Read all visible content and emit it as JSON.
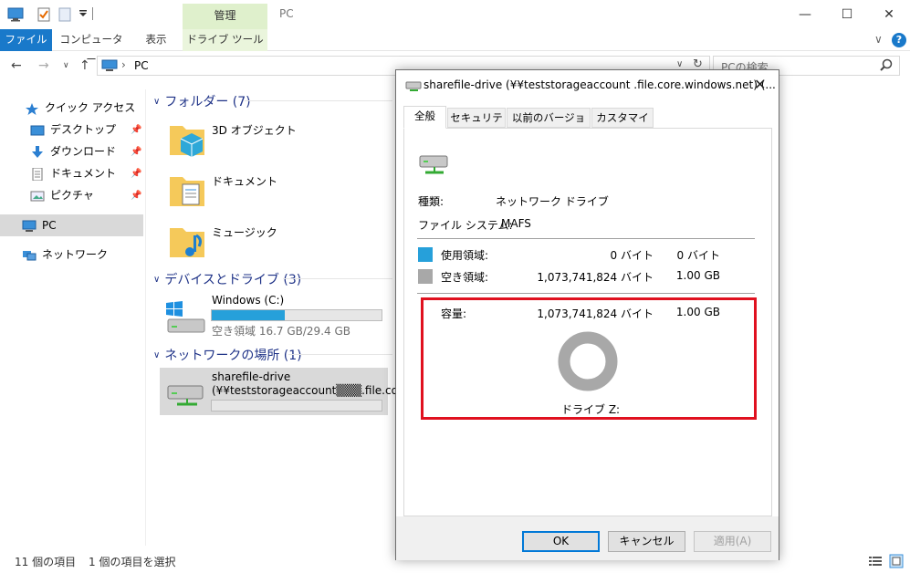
{
  "titlebar": {
    "manage_tab": "管理",
    "window_title": "PC",
    "minimize": "—",
    "maximize": "☐",
    "close": "✕"
  },
  "ribbon": {
    "tabs": [
      "ファイル",
      "コンピューター",
      "表示",
      "ドライブ ツール"
    ],
    "expand": "∨",
    "help": "?"
  },
  "address": {
    "path_sep": "›",
    "path": "PC",
    "search_placeholder": "PCの検索"
  },
  "sidebar": {
    "quick_access": "クイック アクセス",
    "desktop": "デスクトップ",
    "downloads": "ダウンロード",
    "documents": "ドキュメント",
    "pictures": "ピクチャ",
    "pc": "PC",
    "network": "ネットワーク"
  },
  "main": {
    "folders_header": "フォルダー (7)",
    "folders": [
      "3D オブジェクト",
      "ドキュメント",
      "ミュージック"
    ],
    "devices_header": "デバイスとドライブ (3)",
    "drive_c_name": "Windows (C:)",
    "drive_c_free": "空き領域 16.7 GB/29.4 GB",
    "drive_c_used_fraction": 0.43,
    "network_header": "ネットワークの場所 (1)",
    "share_name": "sharefile-drive",
    "share_path": "(¥¥teststorageaccount▒▒▒.file.co..."
  },
  "status": {
    "items": "11 個の項目",
    "selected": "1 個の項目を選択"
  },
  "dialog": {
    "title": "sharefile-drive (¥¥teststorageaccount        .file.core.windows.net) (...",
    "close": "✕",
    "tabs": [
      "全般",
      "セキュリティ",
      "以前のバージョン",
      "カスタマイズ"
    ],
    "type_label": "種類:",
    "type_value": "ネットワーク ドライブ",
    "fs_label": "ファイル システム:",
    "fs_value": "MAFS",
    "used_label": "使用領域:",
    "used_bytes": "0 バイト",
    "used_size": "0 バイト",
    "free_label": "空き領域:",
    "free_bytes": "1,073,741,824 バイト",
    "free_size": "1.00 GB",
    "capacity_label": "容量:",
    "capacity_bytes": "1,073,741,824 バイト",
    "capacity_size": "1.00 GB",
    "drive_label": "ドライブ Z:",
    "ok": "OK",
    "cancel": "キャンセル",
    "apply": "適用(A)",
    "used_color": "#26a0da",
    "free_color": "#a8a8a8"
  }
}
